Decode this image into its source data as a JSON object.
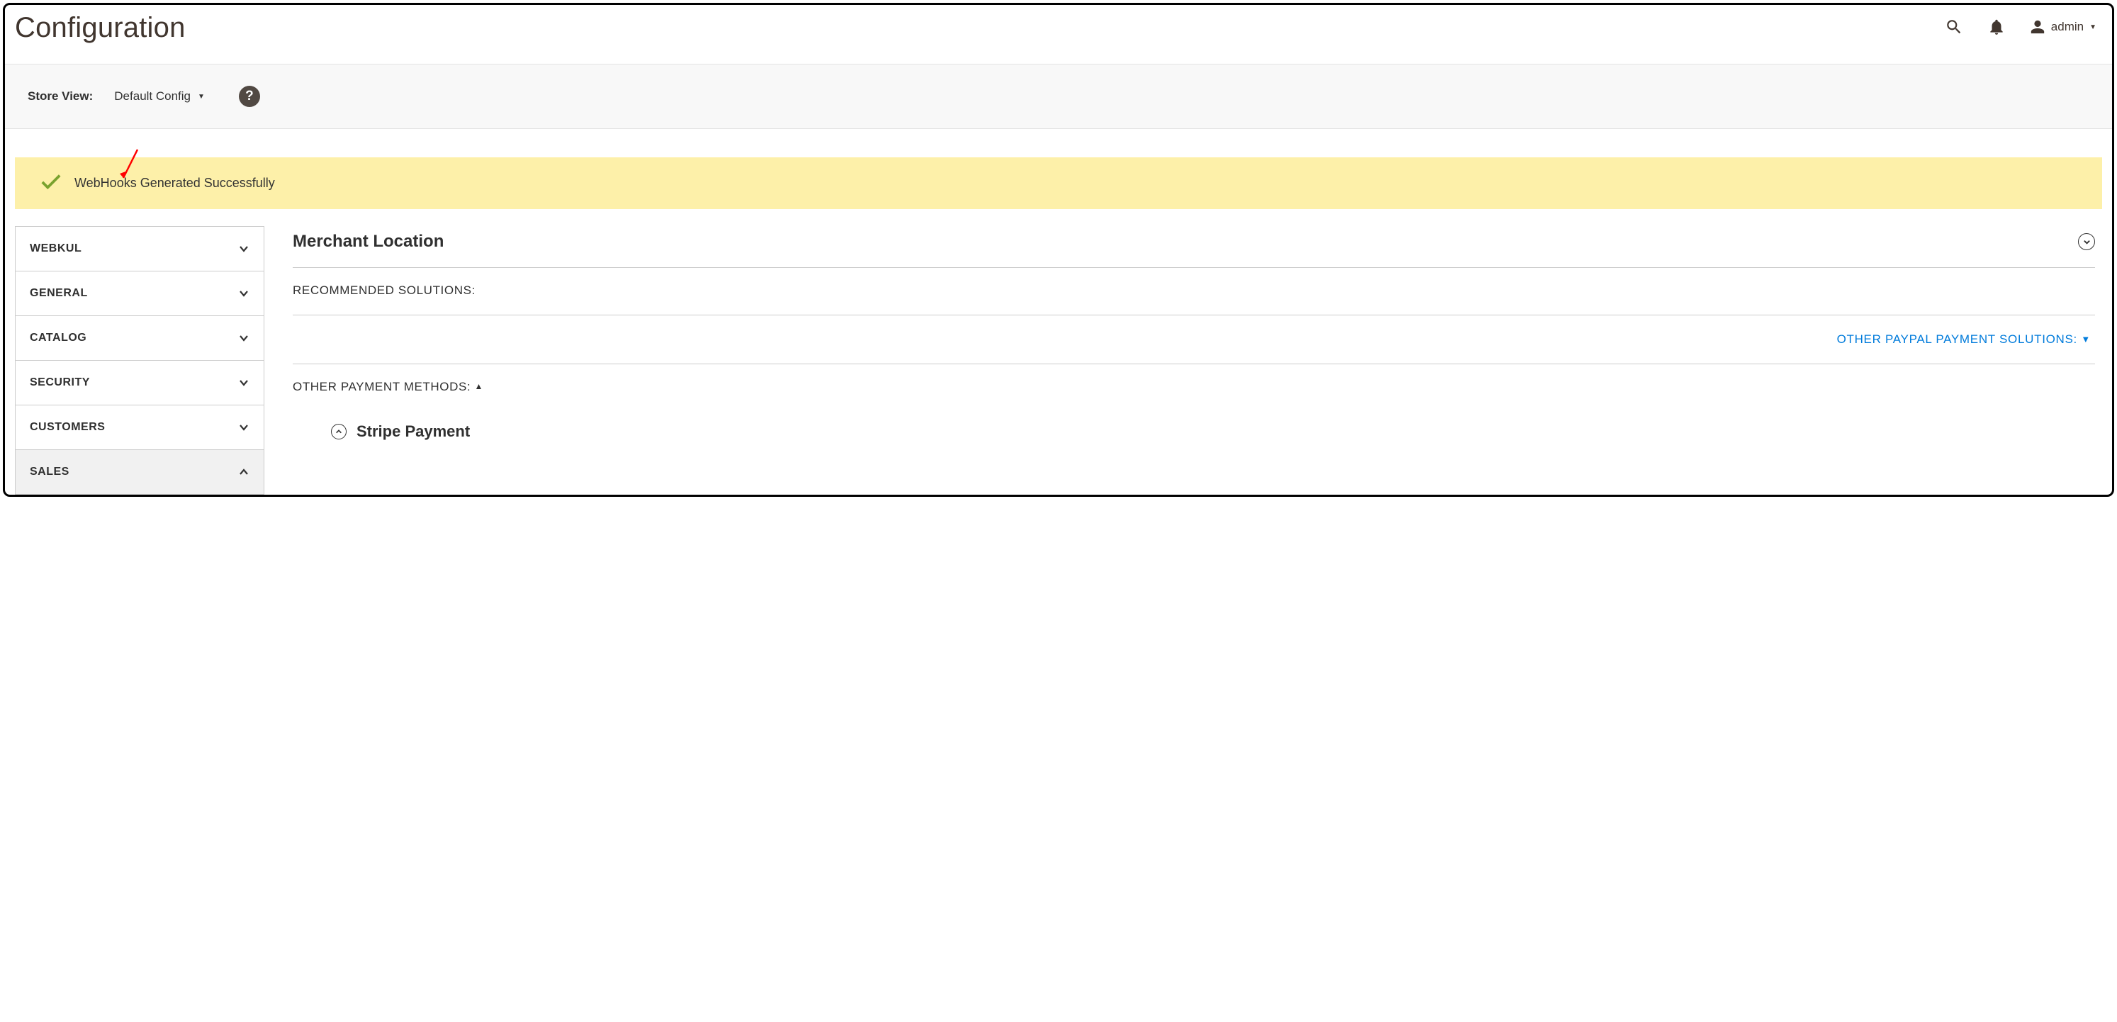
{
  "header": {
    "title": "Configuration",
    "admin_label": "admin"
  },
  "storebar": {
    "label": "Store View:",
    "selected": "Default Config"
  },
  "banner": {
    "message": "WebHooks Generated Successfully"
  },
  "sidebar": {
    "items": [
      {
        "label": "WEBKUL",
        "expanded": false,
        "active": false
      },
      {
        "label": "GENERAL",
        "expanded": false,
        "active": false
      },
      {
        "label": "CATALOG",
        "expanded": false,
        "active": false
      },
      {
        "label": "SECURITY",
        "expanded": false,
        "active": false
      },
      {
        "label": "CUSTOMERS",
        "expanded": false,
        "active": false
      },
      {
        "label": "SALES",
        "expanded": true,
        "active": true
      }
    ]
  },
  "main": {
    "merchant_location": "Merchant Location",
    "recommended": "RECOMMENDED SOLUTIONS:",
    "paypal_link": "OTHER PAYPAL PAYMENT SOLUTIONS:",
    "other_methods": "OTHER PAYMENT METHODS:",
    "stripe": "Stripe Payment"
  }
}
